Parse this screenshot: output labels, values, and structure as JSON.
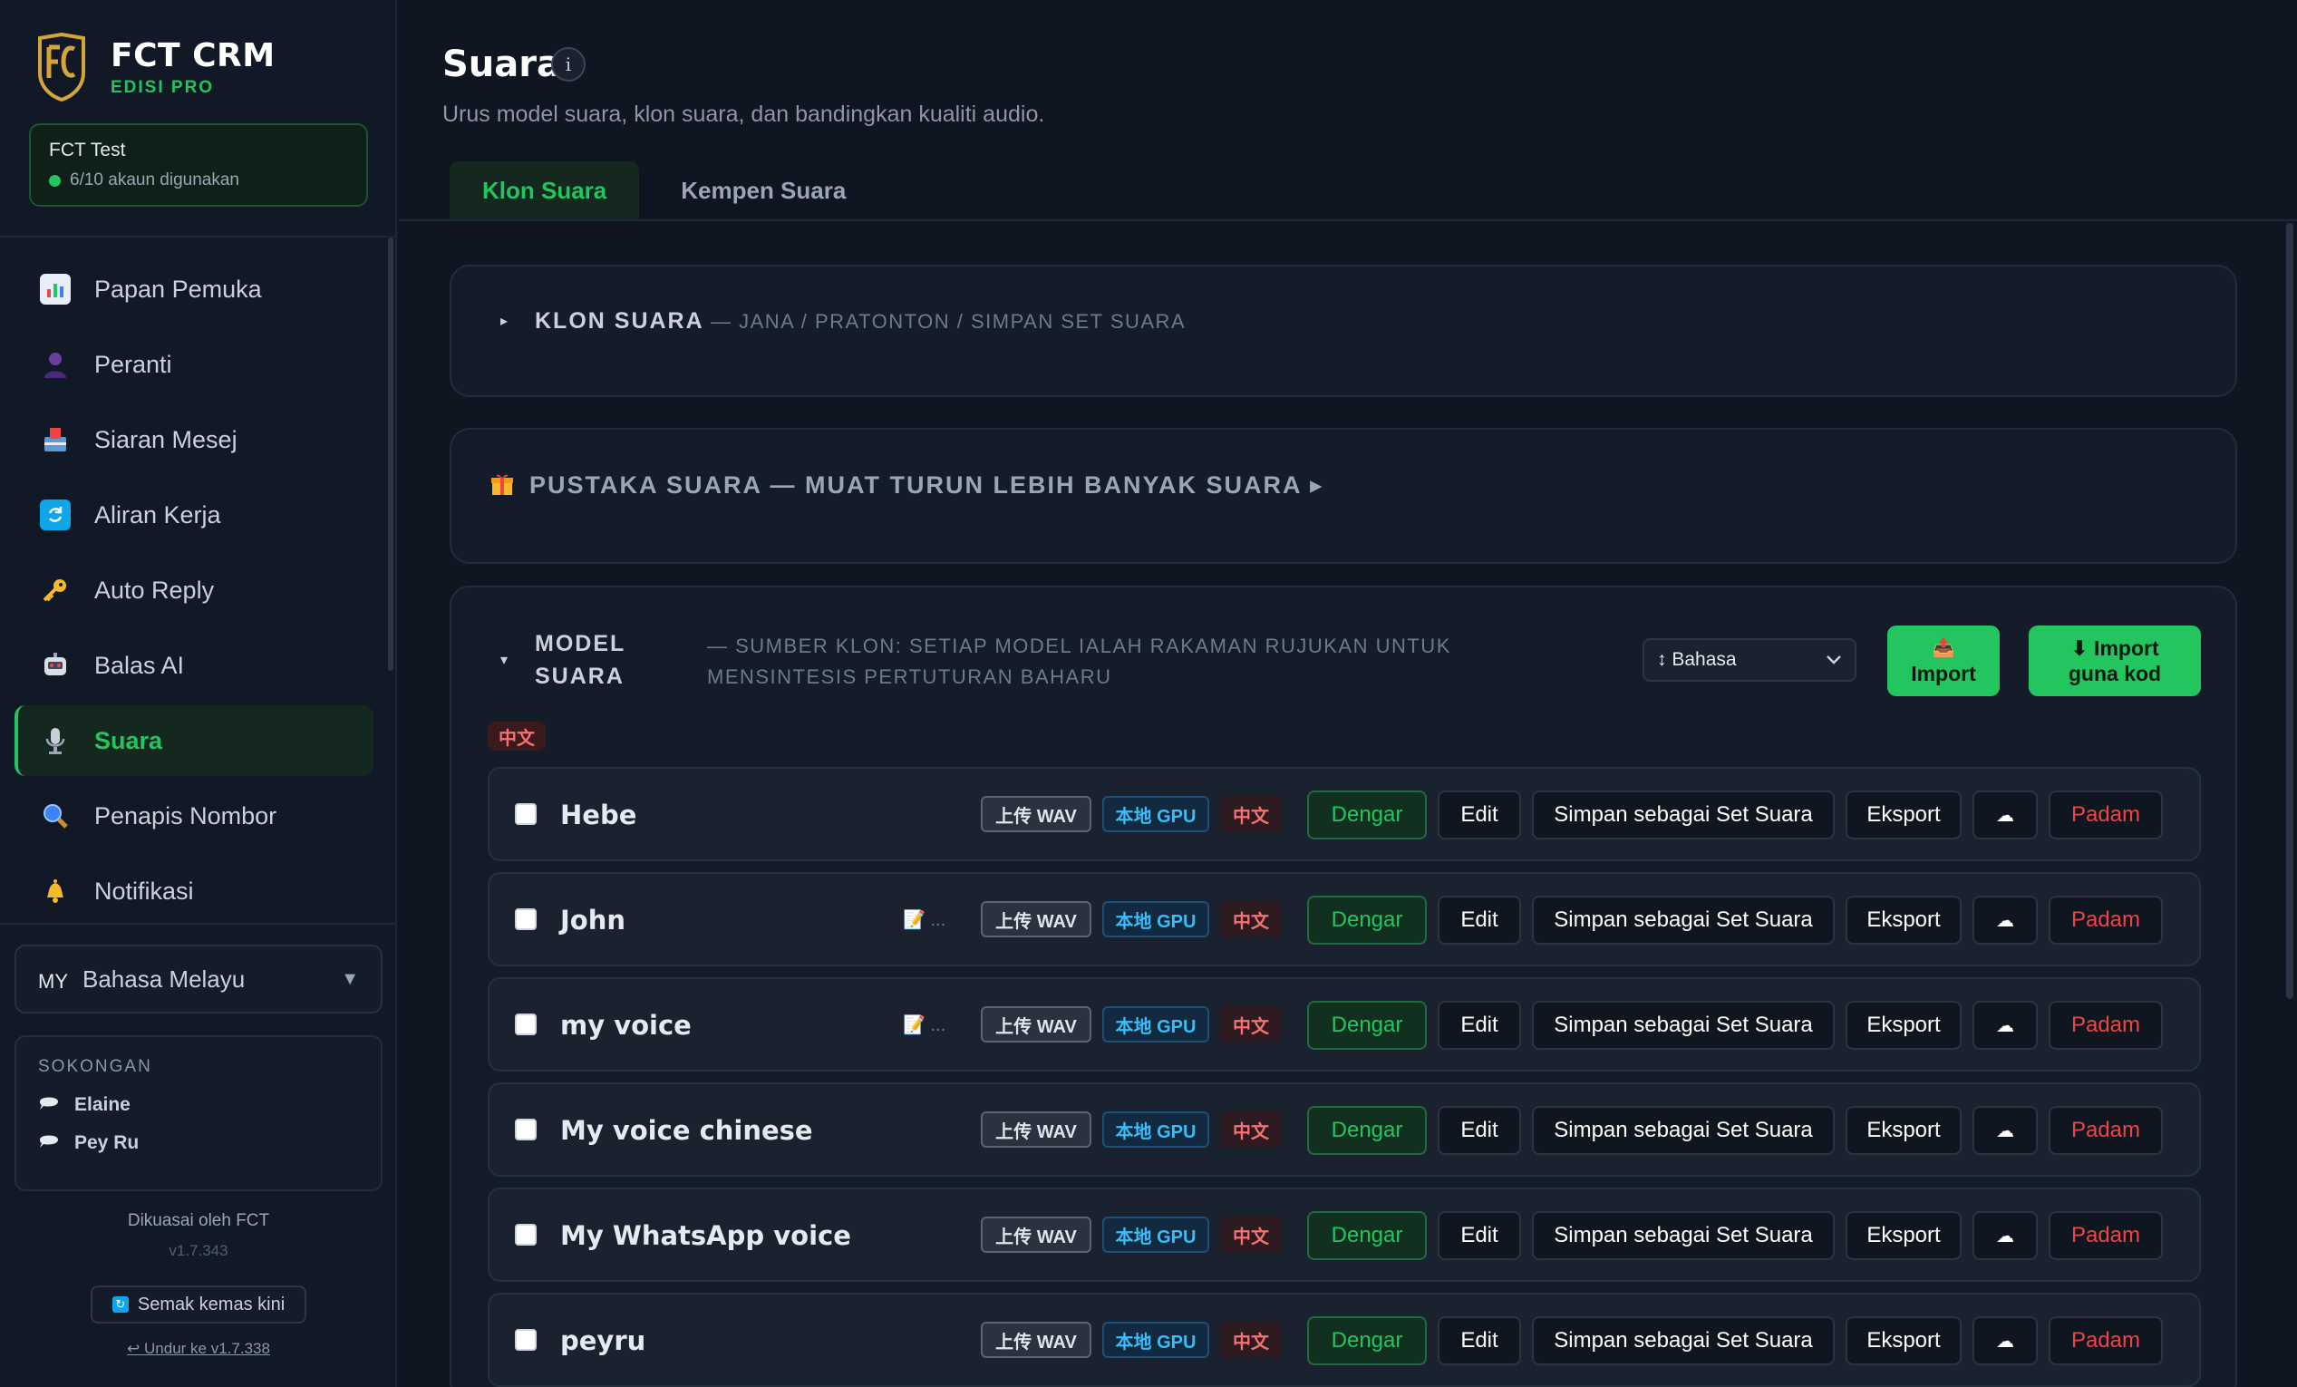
{
  "brand": {
    "title": "FCT CRM",
    "subtitle": "EDISI PRO",
    "logo_icon": "fc-shield-logo"
  },
  "account": {
    "name": "FCT Test",
    "status": "6/10 akaun digunakan"
  },
  "nav": [
    {
      "label": "Papan Pemuka",
      "icon": "bar-chart-icon"
    },
    {
      "label": "Peranti",
      "icon": "person-icon"
    },
    {
      "label": "Siaran Mesej",
      "icon": "inbox-icon"
    },
    {
      "label": "Aliran Kerja",
      "icon": "refresh-icon"
    },
    {
      "label": "Auto Reply",
      "icon": "key-icon"
    },
    {
      "label": "Balas AI",
      "icon": "robot-icon"
    },
    {
      "label": "Suara",
      "icon": "microphone-icon"
    },
    {
      "label": "Penapis Nombor",
      "icon": "magnifier-icon"
    },
    {
      "label": "Notifikasi",
      "icon": "bell-icon"
    }
  ],
  "language": {
    "code": "MY",
    "label": "Bahasa Melayu"
  },
  "support": {
    "title": "SOKONGAN",
    "contacts": [
      "Elaine",
      "Pey Ru"
    ]
  },
  "footer": {
    "powered": "Dikuasai oleh FCT",
    "version": "v1.7.343",
    "update_label": "Semak kemas kini",
    "rollback": "↩ Undur ke v1.7.338"
  },
  "page": {
    "title": "Suara",
    "subtitle": "Urus model suara, klon suara, dan bandingkan kualiti audio."
  },
  "tabs": [
    "Klon Suara",
    "Kempen Suara"
  ],
  "clone_panel": {
    "title": "KLON SUARA",
    "desc": "— JANA / PRATONTON / SIMPAN SET SUARA"
  },
  "library_panel": {
    "title": "PUSTAKA SUARA — MUAT TURUN LEBIH BANYAK SUARA ▸"
  },
  "model_panel": {
    "title": "MODEL SUARA",
    "desc": "— SUMBER KLON: SETIAP MODEL IALAH RAKAMAN RUJUKAN UNTUK MENSINTESIS PERTUTURAN BAHARU",
    "sort_label": "↕ Bahasa",
    "import_line1": "📤",
    "import_line2": "Import",
    "import_code_line1": "⬇ Import",
    "import_code_line2": "guna kod",
    "group_badge": "中文"
  },
  "row_labels": {
    "tag_wav": "上传 WAV",
    "tag_gpu": "本地 GPU",
    "tag_lang": "中文",
    "listen": "Dengar",
    "edit": "Edit",
    "save": "Simpan sebagai Set Suara",
    "export": "Eksport",
    "cloud": "☁",
    "delete": "Padam",
    "note": "📝 ..."
  },
  "voices": [
    {
      "name": "Hebe",
      "has_note": false
    },
    {
      "name": "John",
      "has_note": true
    },
    {
      "name": "my voice",
      "has_note": true
    },
    {
      "name": "My voice chinese",
      "has_note": false
    },
    {
      "name": "My WhatsApp voice",
      "has_note": false
    },
    {
      "name": "peyru",
      "has_note": false
    }
  ],
  "colors": {
    "accent": "#22c55e",
    "danger": "#ef4444",
    "gpu": "#38bdf8",
    "background": "#0f1521"
  }
}
